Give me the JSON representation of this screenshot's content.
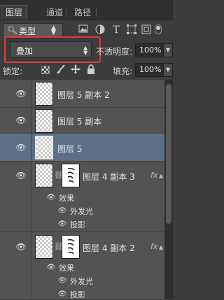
{
  "tabs": [
    {
      "label": "图层",
      "active": true
    },
    {
      "label": "通道",
      "active": false
    },
    {
      "label": "路径",
      "active": false
    }
  ],
  "filter": {
    "kind_label": "类型",
    "icons": [
      "image-filter-icon",
      "adjustment-filter-icon",
      "type-filter-icon",
      "shape-filter-icon",
      "smart-object-filter-icon"
    ]
  },
  "blend": {
    "mode": "叠加",
    "opacity_label": "不透明度:",
    "opacity_value": "100%"
  },
  "lock": {
    "label": "锁定:",
    "fill_label": "填充:",
    "fill_value": "100%"
  },
  "layers": [
    {
      "name": "图层 5 副本 2"
    },
    {
      "name": "图层 5 副本"
    },
    {
      "name": "图层 5",
      "selected": true
    },
    {
      "name": "图层 4 副本 3",
      "fx": "fx",
      "effects_label": "效果",
      "effects": [
        "外发光",
        "投影"
      ]
    },
    {
      "name": "图层 4 副本 2",
      "fx": "fx",
      "effects_label": "效果",
      "effects": [
        "外发光",
        "投影"
      ]
    }
  ],
  "colors": {
    "highlight": "#e03a3a",
    "selected_row": "#5c6f86"
  }
}
